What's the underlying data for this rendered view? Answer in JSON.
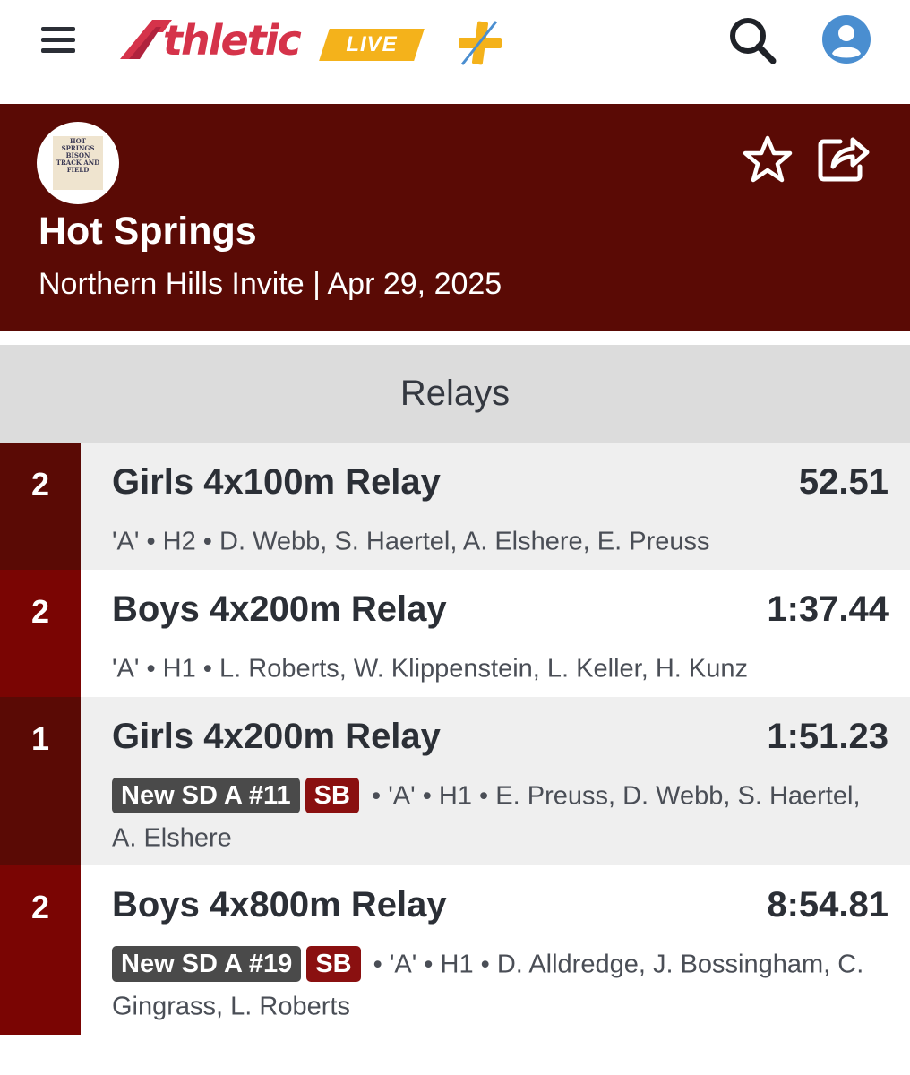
{
  "app": {
    "logo_text": "thletic",
    "logo_live": "LIVE",
    "colors": {
      "brand_red": "#d5334a",
      "brand_gold": "#f4b21b",
      "accent_blue": "#4a8ed0"
    }
  },
  "team": {
    "name": "Hot Springs",
    "meet_line": "Northern Hills Invite | Apr 29, 2025",
    "logo_seal_text": "HOT SPRINGS BISON TRACK AND FIELD",
    "header_color": "#5a0a05"
  },
  "section": {
    "title": "Relays"
  },
  "results": [
    {
      "place": "2",
      "event": "Girls 4x100m Relay",
      "mark": "52.51",
      "badges": [],
      "details": "'A' • H2 • D. Webb, S. Haertel, A. Elshere, E. Preuss",
      "place_color": "#5a0a05",
      "row_color": "#efefef"
    },
    {
      "place": "2",
      "event": "Boys 4x200m Relay",
      "mark": "1:37.44",
      "badges": [],
      "details": "'A' • H1 • L. Roberts, W. Klippenstein, L. Keller, H. Kunz",
      "place_color": "#7a0503",
      "row_color": "#ffffff"
    },
    {
      "place": "1",
      "event": "Girls 4x200m Relay",
      "mark": "1:51.23",
      "badges": [
        {
          "text": "New SD A #11",
          "kind": "sd"
        },
        {
          "text": "SB",
          "kind": "sb"
        }
      ],
      "details": "• 'A' • H1 • E. Preuss, D. Webb, S. Haertel, A. Elshere",
      "place_color": "#5a0a05",
      "row_color": "#efefef"
    },
    {
      "place": "2",
      "event": "Boys 4x800m Relay",
      "mark": "8:54.81",
      "badges": [
        {
          "text": "New SD A #19",
          "kind": "sd"
        },
        {
          "text": "SB",
          "kind": "sb"
        }
      ],
      "details": "• 'A' • H1 • D. Alldredge, J. Bossingham, C. Gingrass, L. Roberts",
      "place_color": "#7a0503",
      "row_color": "#ffffff"
    }
  ]
}
